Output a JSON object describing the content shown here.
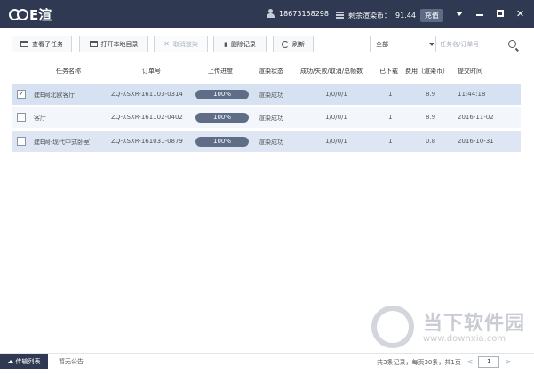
{
  "app": {
    "title": "E渲"
  },
  "user": {
    "phone": "18673158298"
  },
  "balance": {
    "label": "剩余渲染币：",
    "value": "91.44",
    "recharge_label": "充值"
  },
  "toolbar": {
    "view_subtasks": "查看子任务",
    "open_local_dir": "打开本地目录",
    "cancel_render": "取消渲染",
    "delete_record": "删除记录",
    "refresh": "刷新",
    "filter_value": "全部",
    "search_placeholder": "任务名/订单号"
  },
  "table": {
    "headers": {
      "task_name": "任务名称",
      "order_no": "订单号",
      "upload_progress": "上传进度",
      "render_status": "渲染状态",
      "counts": "成功/失败/取消/总帧数",
      "downloaded": "已下载",
      "cost": "费用（渲染币）",
      "submit_time": "提交时间"
    },
    "rows": [
      {
        "checked": true,
        "name": "建E网北欧客厅",
        "order": "ZQ-XSXR-161103-0314",
        "progress": 1.0,
        "progress_label": "100%",
        "status": "渲染成功",
        "counts": "1/0/0/1",
        "downloaded": "1",
        "cost": "8.9",
        "time": "11:44:18"
      },
      {
        "checked": false,
        "name": "客厅",
        "order": "ZQ-XSXR-161102-0402",
        "progress": 1.0,
        "progress_label": "100%",
        "status": "渲染成功",
        "counts": "1/0/0/1",
        "downloaded": "1",
        "cost": "8.9",
        "time": "2016-11-02"
      },
      {
        "checked": false,
        "name": "建E网-现代中式卧室",
        "order": "ZQ-XSXR-161031-0879",
        "progress": 1.0,
        "progress_label": "100%",
        "status": "渲染成功",
        "counts": "1/0/0/1",
        "downloaded": "1",
        "cost": "0.8",
        "time": "2016-10-31"
      }
    ]
  },
  "footer": {
    "transfer_list": "传输列表",
    "notice": "暂无公告",
    "summary": "共3条记录，每页30条，共1页",
    "page": "1"
  },
  "watermark": {
    "title": "当下软件园",
    "url": "www.downxia.com"
  }
}
